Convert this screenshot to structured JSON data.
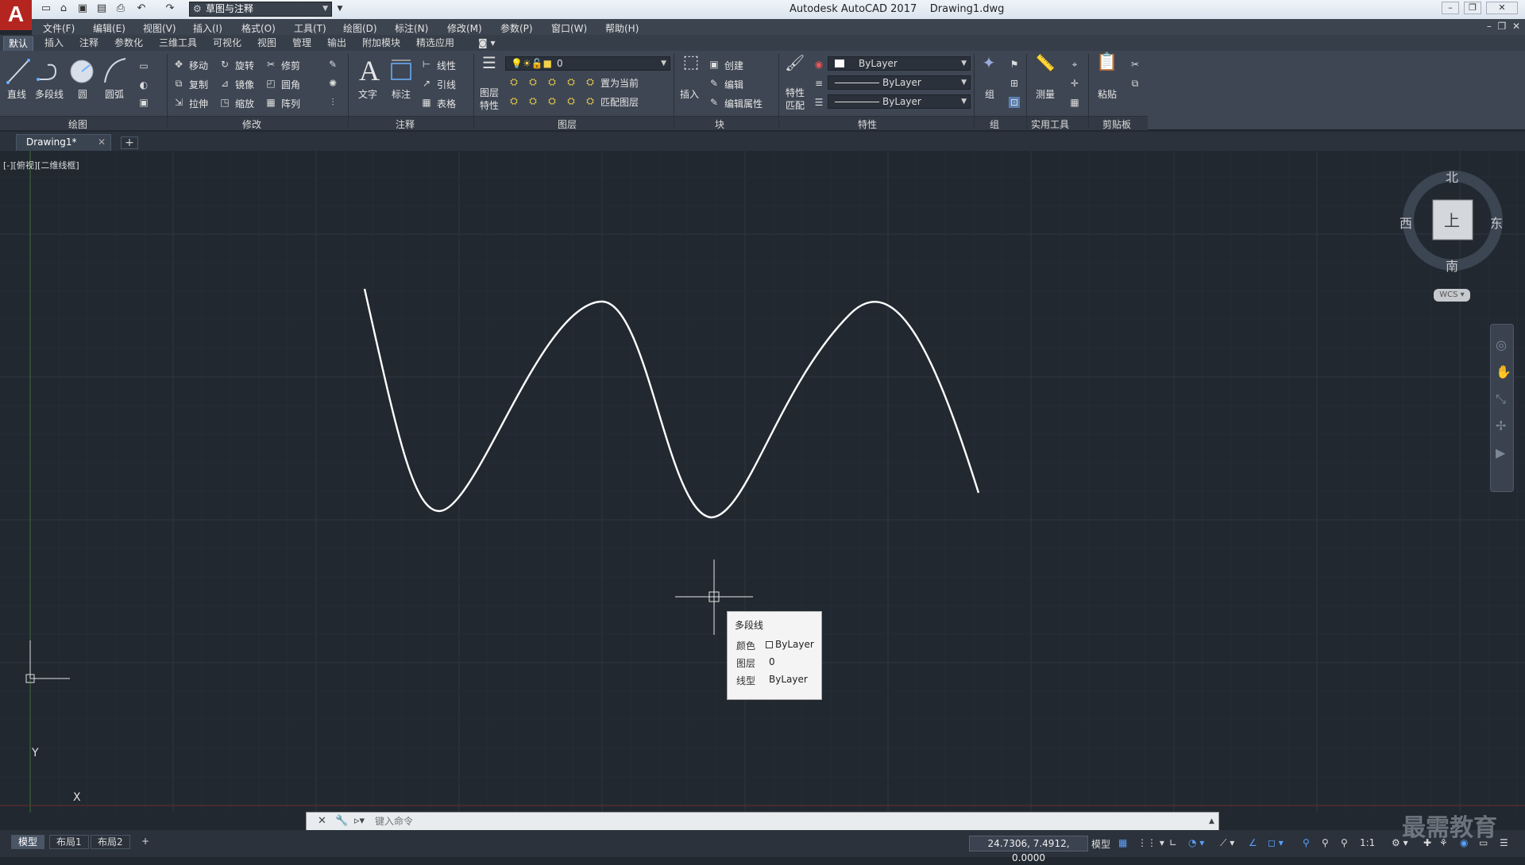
{
  "titlebar": {
    "logo": "A",
    "workspace": "草图与注释",
    "app_title": "Autodesk AutoCAD 2017",
    "file_title": "Drawing1.dwg"
  },
  "menubar": [
    "文件(F)",
    "编辑(E)",
    "视图(V)",
    "插入(I)",
    "格式(O)",
    "工具(T)",
    "绘图(D)",
    "标注(N)",
    "修改(M)",
    "参数(P)",
    "窗口(W)",
    "帮助(H)"
  ],
  "ribbon_tabs": [
    "默认",
    "插入",
    "注释",
    "参数化",
    "三维工具",
    "可视化",
    "视图",
    "管理",
    "输出",
    "附加模块",
    "精选应用"
  ],
  "ribbon": {
    "draw": {
      "title": "绘图",
      "line": "直线",
      "polyline": "多段线",
      "circle": "圆",
      "arc": "圆弧"
    },
    "modify": {
      "title": "修改",
      "move": "移动",
      "rotate": "旋转",
      "trim": "修剪",
      "copy": "复制",
      "mirror": "镜像",
      "fillet": "圆角",
      "stretch": "拉伸",
      "scale": "缩放",
      "array": "阵列"
    },
    "annotation": {
      "title": "注释",
      "text": "文字",
      "dimension": "标注",
      "linear": "线性",
      "leader": "引线",
      "table": "表格"
    },
    "layers": {
      "title": "图层",
      "layer_props_1": "图层",
      "layer_props_2": "特性",
      "current_layer": "0",
      "set_current": "置为当前",
      "match_layer": "匹配图层"
    },
    "block": {
      "title": "块",
      "insert": "插入",
      "create": "创建",
      "edit": "编辑",
      "edit_attr": "编辑属性"
    },
    "properties": {
      "title": "特性",
      "match_1": "特性",
      "match_2": "匹配",
      "color": "ByLayer",
      "linetype": "ByLayer",
      "lineweight": "ByLayer"
    },
    "groups": {
      "title": "组",
      "group": "组"
    },
    "utilities": {
      "title": "实用工具",
      "measure": "测量"
    },
    "clipboard": {
      "title": "剪贴板",
      "paste": "粘贴"
    }
  },
  "file_tab": "Drawing1*",
  "viewport_label": "[-][俯视][二维线框]",
  "viewcube": {
    "north": "北",
    "south": "南",
    "east": "东",
    "west": "西",
    "face": "上",
    "wcs": "WCS"
  },
  "ucs": {
    "x": "X",
    "y": "Y"
  },
  "tooltip": {
    "title": "多段线",
    "rows": [
      {
        "key": "颜色",
        "value": "ByLayer"
      },
      {
        "key": "图层",
        "value": "0"
      },
      {
        "key": "线型",
        "value": "ByLayer"
      }
    ]
  },
  "command": {
    "placeholder": "键入命令"
  },
  "layout_tabs": [
    "模型",
    "布局1",
    "布局2"
  ],
  "status": {
    "coords": "24.7306, 7.4912, 0.0000",
    "model": "模型",
    "scale": "1:1"
  },
  "watermark": "最需教育",
  "colors": {
    "canvas": "#212830",
    "ribbon": "#3e4653",
    "logo": "#b5251f",
    "curve": "#ffffff"
  }
}
